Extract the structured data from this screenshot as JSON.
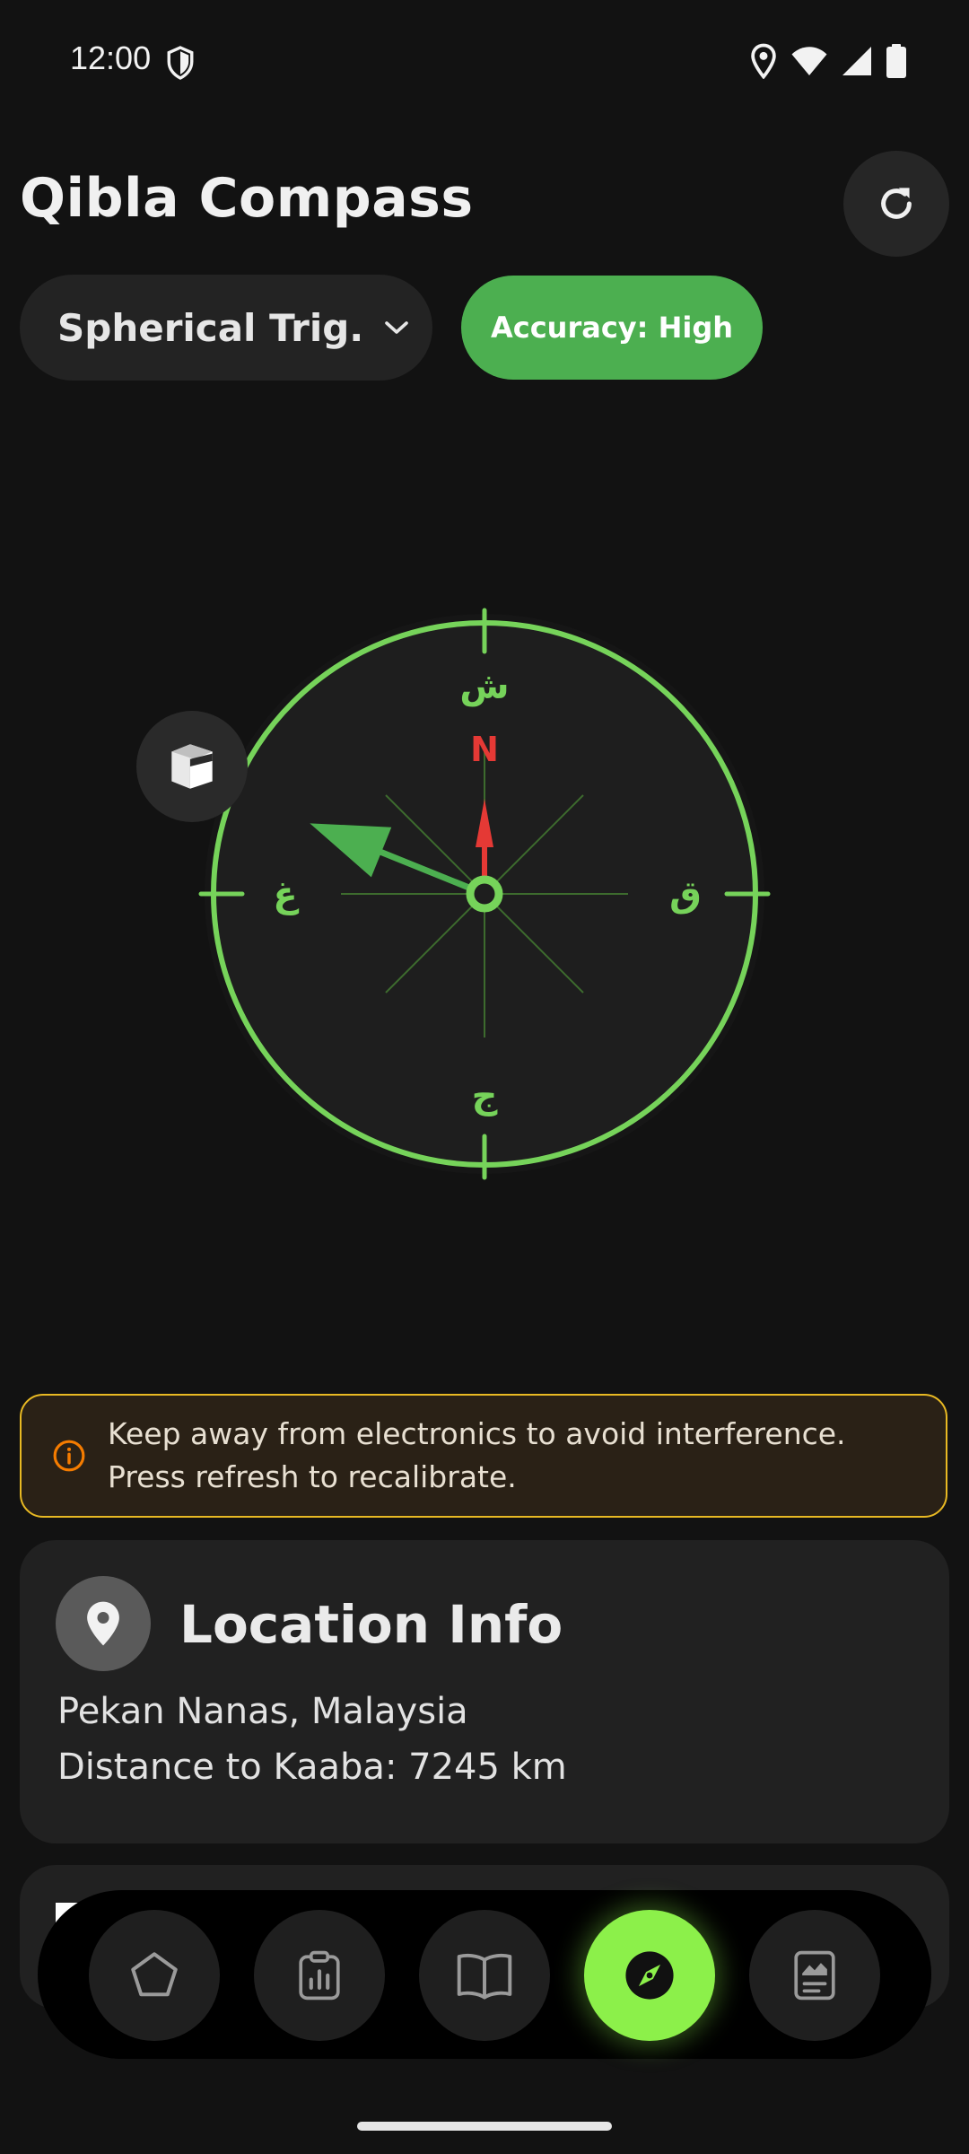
{
  "status_bar": {
    "time": "12:00",
    "icons": [
      "shield-icon",
      "location-icon",
      "wifi-icon",
      "signal-icon",
      "battery-icon"
    ]
  },
  "header": {
    "title": "Qibla Compass",
    "refresh_icon": "refresh-icon"
  },
  "method_selector": {
    "selected": "Spherical Trig.",
    "icon": "chevron-down-icon"
  },
  "accuracy": {
    "label": "Accuracy: High",
    "color": "#4caf50"
  },
  "compass": {
    "north_label": "N",
    "cardinal_top": "ش",
    "cardinal_right": "ق",
    "cardinal_bottom": "ج",
    "cardinal_left": "غ",
    "qibla_heading_deg": 292,
    "ring_color": "#76d35a",
    "needle_color": "#e53935",
    "kaaba_icon": "kaaba-icon"
  },
  "warning": {
    "line1": "Keep away from electronics to avoid interference.",
    "line2": "Press refresh to recalibrate.",
    "icon": "info-icon",
    "border_color": "#e8b923"
  },
  "location_card": {
    "title": "Location Info",
    "icon": "location-pin-icon",
    "city": "Pekan Nanas, Malaysia",
    "distance": "Distance to Kaaba: 7245 km"
  },
  "bottom_nav": {
    "items": [
      {
        "icon": "pentagon-icon",
        "active": false
      },
      {
        "icon": "clipboard-chart-icon",
        "active": false
      },
      {
        "icon": "book-icon",
        "active": false
      },
      {
        "icon": "compass-icon",
        "active": true
      },
      {
        "icon": "report-icon",
        "active": false
      }
    ],
    "active_color": "#8cf04a"
  }
}
